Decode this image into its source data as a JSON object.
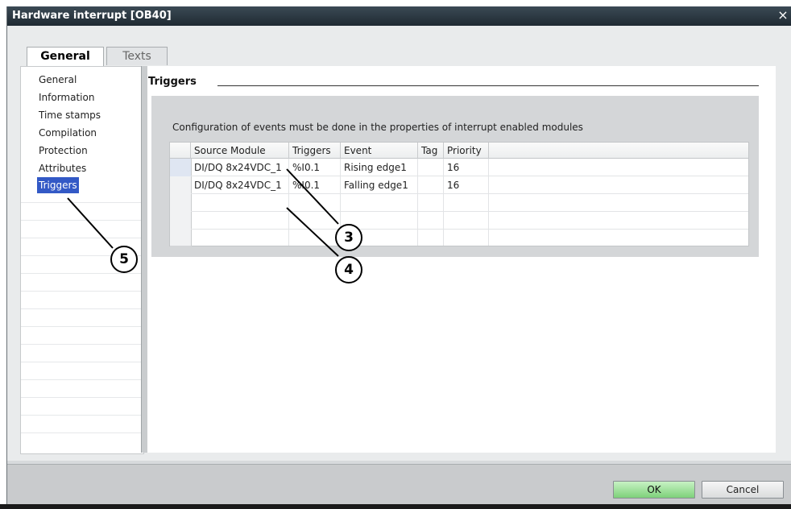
{
  "window": {
    "title": "Hardware interrupt [OB40]",
    "close_glyph": "×"
  },
  "tabs": [
    {
      "label": "General",
      "active": true
    },
    {
      "label": "Texts",
      "active": false
    }
  ],
  "sidebar": {
    "items": [
      {
        "label": "General"
      },
      {
        "label": "Information"
      },
      {
        "label": "Time stamps"
      },
      {
        "label": "Compilation"
      },
      {
        "label": "Protection"
      },
      {
        "label": "Attributes"
      },
      {
        "label": "Triggers",
        "selected": true
      }
    ]
  },
  "main": {
    "section_title": "Triggers",
    "config_text": "Configuration of events must be done in the properties of interrupt enabled modules",
    "table": {
      "columns": [
        "Source Module",
        "Triggers",
        "Event",
        "Tag",
        "Priority"
      ],
      "rows": [
        [
          "DI/DQ 8x24VDC_1",
          "%I0.1",
          "Rising edge1",
          "",
          "16"
        ],
        [
          "DI/DQ 8x24VDC_1",
          "%I0.1",
          "Falling edge1",
          "",
          "16"
        ]
      ]
    }
  },
  "footer": {
    "ok_label": "OK",
    "cancel_label": "Cancel"
  },
  "callouts": {
    "c3": "3",
    "c4": "4",
    "c5": "5"
  },
  "colors": {
    "selection": "#3359c6",
    "ok_button": "#7ed17a",
    "titlebar": "#2a3640"
  }
}
